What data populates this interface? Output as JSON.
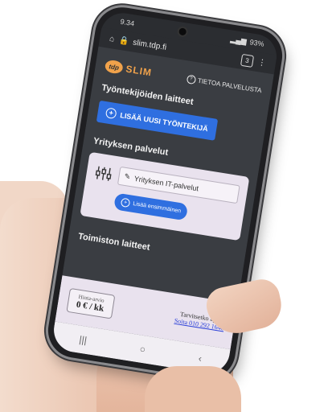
{
  "status": {
    "time": "9.34",
    "battery": "93%"
  },
  "browser": {
    "url": "slim.tdp.fi",
    "tabs_count": "3"
  },
  "app": {
    "logo_badge": "tdp",
    "logo_text": "SLIM",
    "info_label": "TIETOA PALVELUSTA"
  },
  "employees": {
    "title": "Työntekijöiden laitteet",
    "add_button": "LISÄÄ UUSI TYÖNTEKIJÄ"
  },
  "company_services": {
    "title": "Yrityksen palvelut",
    "field_value": "Yrityksen IT-palvelut",
    "add_first": "Lisää ensimmäinen"
  },
  "office": {
    "title": "Toimiston laitteet"
  },
  "footer": {
    "price_label": "Hinta-arvio",
    "price_value": "0 € / kk",
    "help_question": "Tarvitsetko apua?",
    "help_link": "Soita 010 292 1640"
  },
  "icons": {
    "home": "home-icon",
    "lock": "lock-icon",
    "menu": "more-vert-icon",
    "question": "question-circle-icon",
    "plus": "plus-circle-icon",
    "sliders": "sliders-icon",
    "pencil": "pencil-icon",
    "recents": "recents-icon",
    "homebtn": "home-button-icon",
    "back": "back-icon"
  },
  "colors": {
    "accent": "#2f6fe0",
    "brand": "#f0a24b",
    "background": "#3a3d42",
    "card": "#e9e2ee"
  }
}
